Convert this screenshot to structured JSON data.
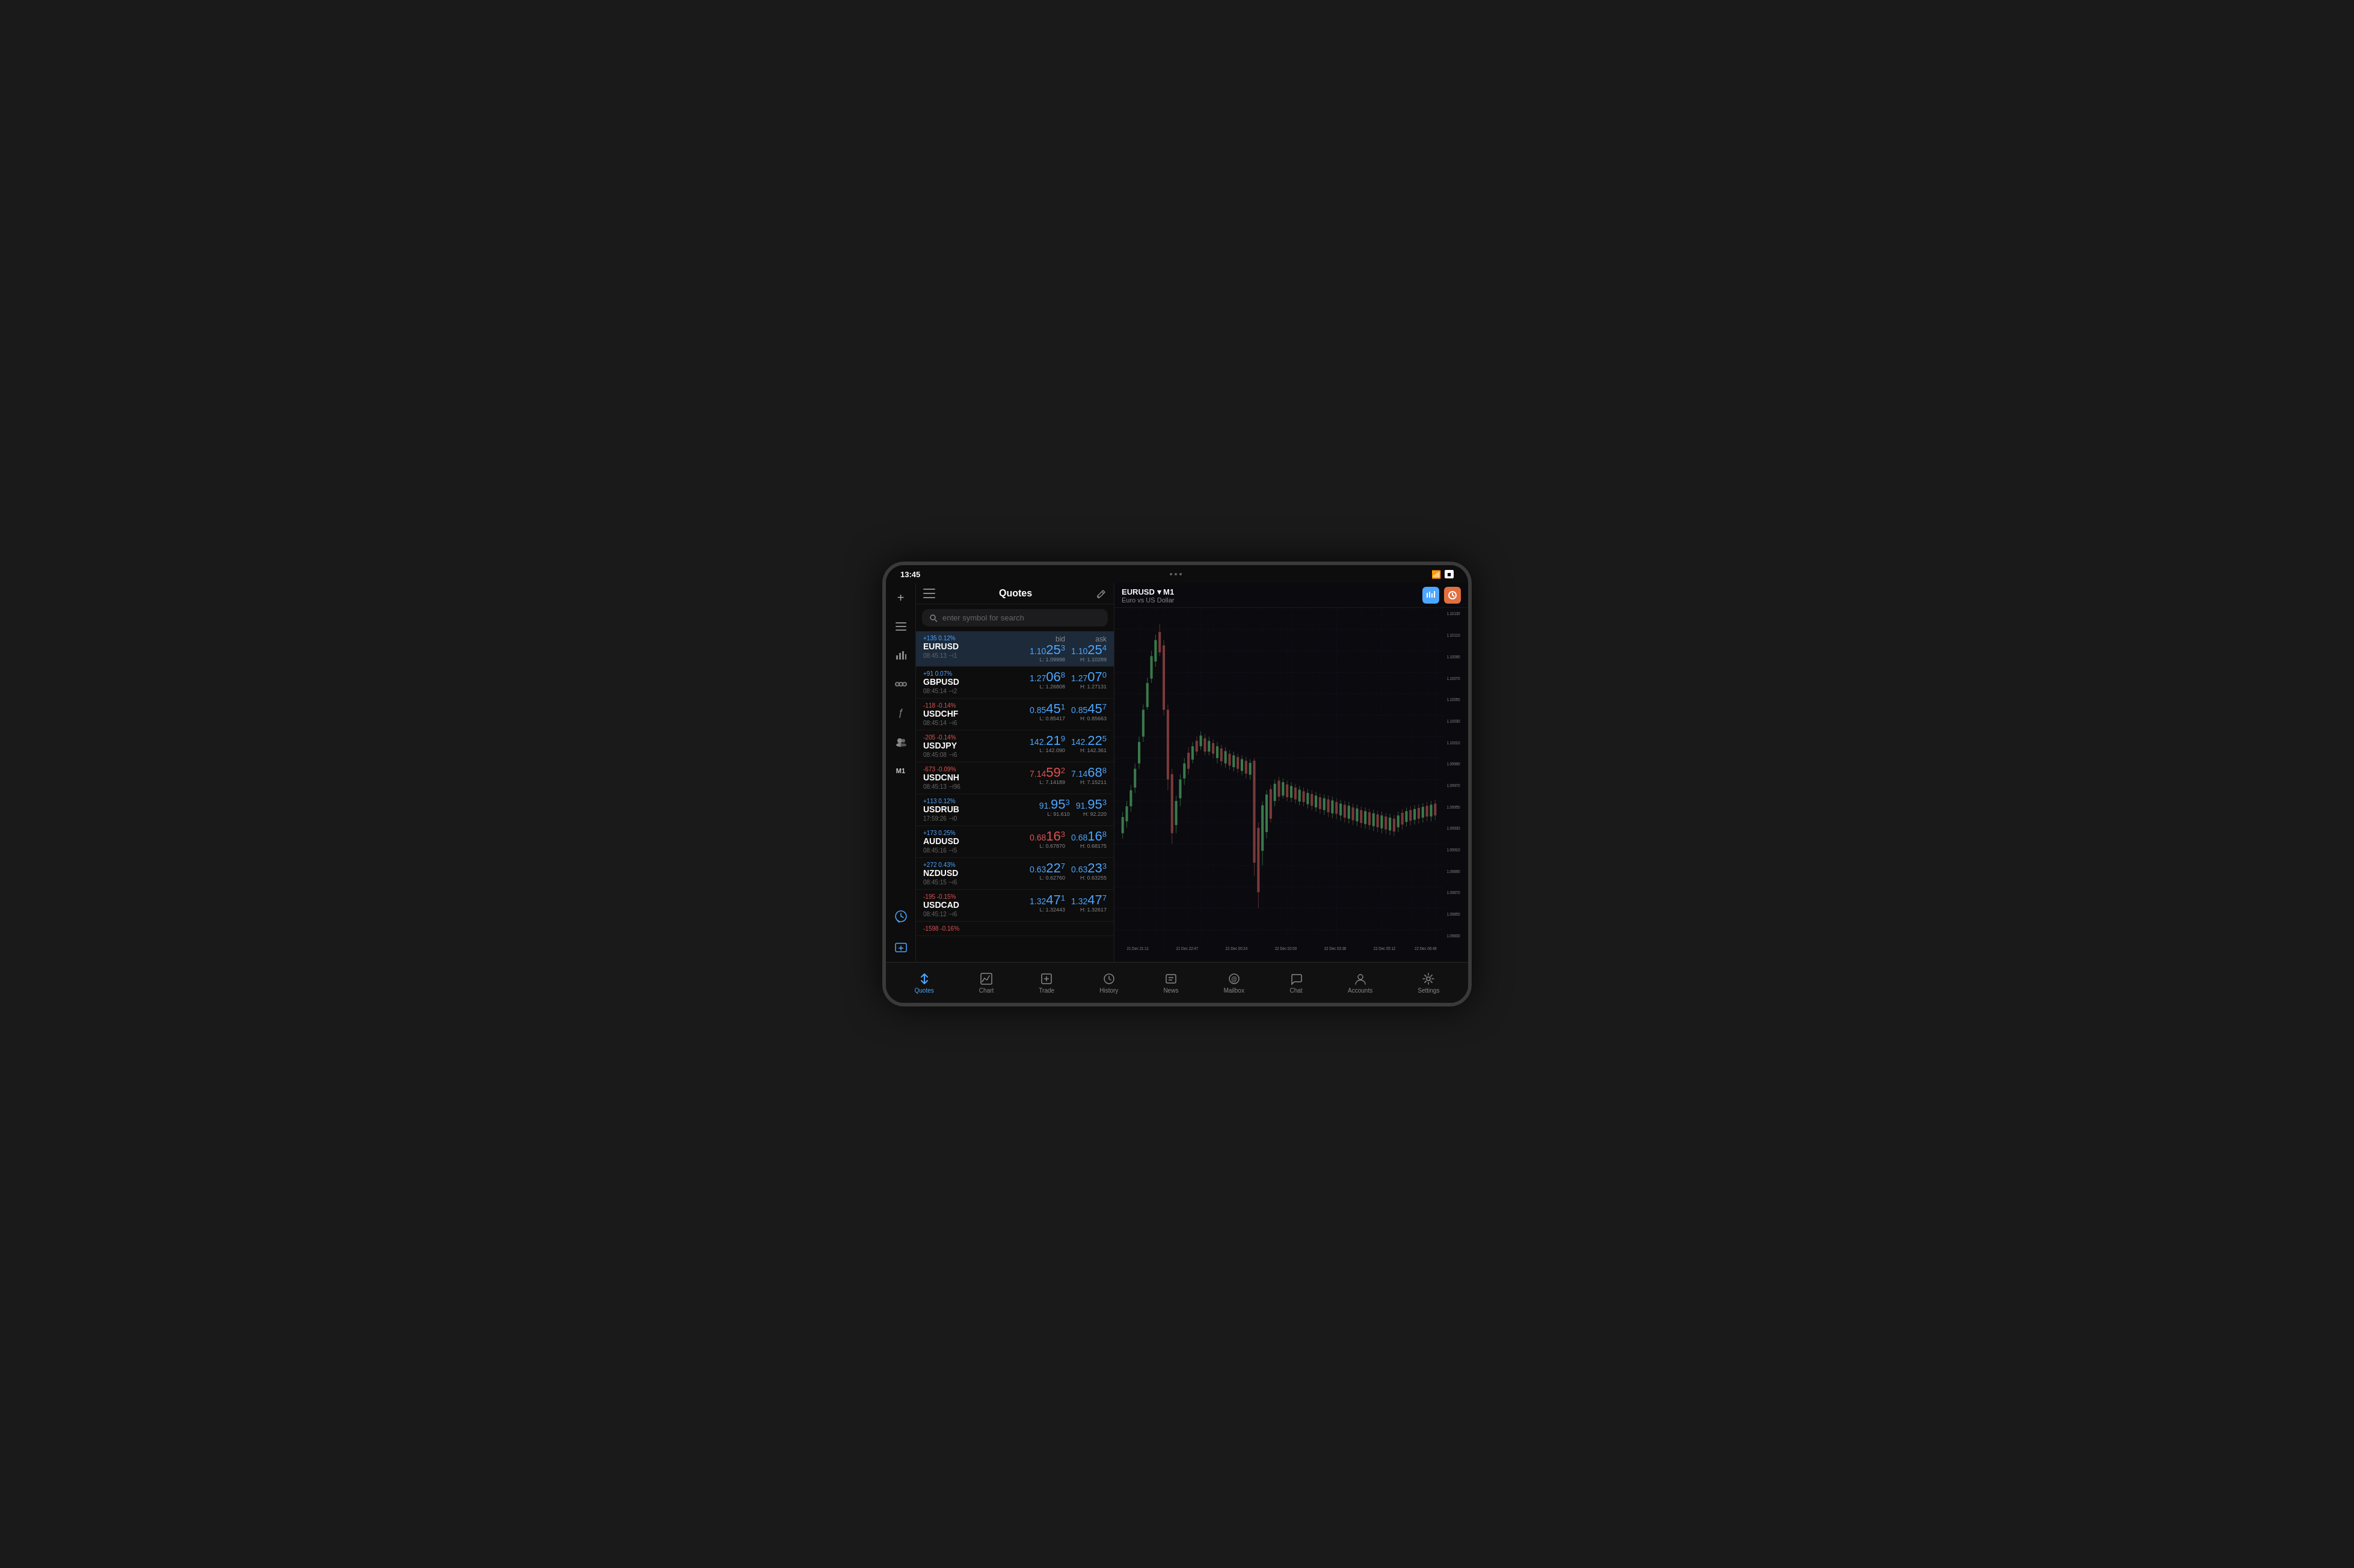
{
  "status_bar": {
    "time": "13:45",
    "wifi_icon": "wifi",
    "battery_icon": "battery"
  },
  "sidebar": {
    "icons": [
      {
        "name": "add-icon",
        "symbol": "+",
        "active": false
      },
      {
        "name": "list-icon",
        "symbol": "≡",
        "active": false
      },
      {
        "name": "chart-bar-icon",
        "symbol": "📊",
        "active": false
      },
      {
        "name": "filter-icon",
        "symbol": "⚙",
        "active": false
      },
      {
        "name": "script-icon",
        "symbol": "ƒ",
        "active": false
      },
      {
        "name": "social-icon",
        "symbol": "👥",
        "active": false
      },
      {
        "name": "m1-label",
        "symbol": "M1",
        "active": true
      }
    ],
    "bottom_icons": [
      {
        "name": "chart-bottom-icon",
        "symbol": "◎"
      },
      {
        "name": "add-bottom-icon",
        "symbol": "⊕"
      }
    ]
  },
  "quotes_panel": {
    "title": "Quotes",
    "search_placeholder": "enter symbol for search",
    "items": [
      {
        "change": "+135 0.12%",
        "change_positive": true,
        "symbol": "EURUSD",
        "time": "08:45:13",
        "spread": "1",
        "bid": "1.1025",
        "bid_sup": "3",
        "ask": "1.1025",
        "ask_sup": "4",
        "low": "L: 1.09998",
        "high": "H: 1.10289",
        "active": true
      },
      {
        "change": "+91 0.07%",
        "change_positive": true,
        "symbol": "GBPUSD",
        "time": "08:45:14",
        "spread": "2",
        "bid": "1.2706",
        "bid_sup": "8",
        "ask": "1.2707",
        "ask_sup": "0",
        "low": "L: 1.26808",
        "high": "H: 1.27131",
        "active": false
      },
      {
        "change": "-118 -0.14%",
        "change_positive": false,
        "symbol": "USDCHF",
        "time": "08:45:14",
        "spread": "6",
        "bid": "0.8545",
        "bid_sup": "1",
        "ask": "0.8545",
        "ask_sup": "7",
        "low": "L: 0.85417",
        "high": "H: 0.85663",
        "active": false
      },
      {
        "change": "-205 -0.14%",
        "change_positive": false,
        "symbol": "USDJPY",
        "time": "08:45:08",
        "spread": "6",
        "bid": "142.21",
        "bid_sup": "9",
        "ask": "142.22",
        "ask_sup": "5",
        "low": "L: 142.090",
        "high": "H: 142.361",
        "active": false
      },
      {
        "change": "-673 -0.09%",
        "change_positive": false,
        "symbol": "USDCNH",
        "time": "08:45:13",
        "spread": "96",
        "bid": "7.1459",
        "bid_sup": "2",
        "ask": "7.1468",
        "ask_sup": "8",
        "low": "L: 7.14189",
        "high": "H: 7.15211",
        "active": false
      },
      {
        "change": "+113 0.12%",
        "change_positive": true,
        "symbol": "USDRUB",
        "time": "17:59:26",
        "spread": "0",
        "bid": "91.95",
        "bid_sup": "3",
        "ask": "91.95",
        "ask_sup": "3",
        "low": "L: 91.610",
        "high": "H: 92.220",
        "active": false
      },
      {
        "change": "+173 0.25%",
        "change_positive": true,
        "symbol": "AUDUSD",
        "time": "08:45:16",
        "spread": "5",
        "bid": "0.6816",
        "bid_sup": "3",
        "ask": "0.6816",
        "ask_sup": "8",
        "low": "L: 0.67870",
        "high": "H: 0.68175",
        "active": false,
        "bid_red": true
      },
      {
        "change": "+272 0.43%",
        "change_positive": true,
        "symbol": "NZDUSD",
        "time": "08:45:15",
        "spread": "6",
        "bid": "0.6322",
        "bid_sup": "7",
        "ask": "0.6323",
        "ask_sup": "3",
        "low": "L: 0.62760",
        "high": "H: 0.63255",
        "active": false
      },
      {
        "change": "-195 -0.15%",
        "change_positive": false,
        "symbol": "USDCAD",
        "time": "08:45:12",
        "spread": "6",
        "bid": "1.3247",
        "bid_sup": "1",
        "ask": "1.3247",
        "ask_sup": "7",
        "low": "L: 1.32443",
        "high": "H: 1.32617",
        "active": false
      },
      {
        "change": "-1598 -0.16%",
        "change_positive": false,
        "symbol": "",
        "time": "",
        "spread": "",
        "bid": "",
        "bid_sup": "",
        "ask": "",
        "ask_sup": "",
        "low": "",
        "high": "",
        "active": false,
        "partial": true
      }
    ]
  },
  "chart": {
    "symbol": "EURUSD",
    "timeframe": "M1",
    "description": "Euro vs US Dollar",
    "price_levels": [
      "1.10130",
      "1.10110",
      "1.10090",
      "1.10070",
      "1.10050",
      "1.10030",
      "1.10010",
      "1.09990",
      "1.09970",
      "1.09950",
      "1.09930",
      "1.09910",
      "1.09890",
      "1.09870",
      "1.09850",
      "1.09830"
    ],
    "time_labels": [
      "21 Dec 21:11",
      "21 Dec 22:47",
      "22 Dec 00:24",
      "22 Dec 02:00",
      "22 Dec 03:36",
      "22 Dec 05:12",
      "22 Dec 06:48"
    ]
  },
  "bottom_nav": {
    "items": [
      {
        "id": "quotes",
        "icon": "↑↓",
        "label": "Quotes",
        "active": true
      },
      {
        "id": "chart",
        "icon": "📈",
        "label": "Chart",
        "active": false
      },
      {
        "id": "trade",
        "icon": "⬜",
        "label": "Trade",
        "active": false
      },
      {
        "id": "history",
        "icon": "🕐",
        "label": "History",
        "active": false
      },
      {
        "id": "news",
        "icon": "📰",
        "label": "News",
        "active": false
      },
      {
        "id": "mailbox",
        "icon": "@",
        "label": "Mailbox",
        "active": false
      },
      {
        "id": "chat",
        "icon": "💬",
        "label": "Chat",
        "active": false
      },
      {
        "id": "accounts",
        "icon": "👤",
        "label": "Accounts",
        "active": false
      },
      {
        "id": "settings",
        "icon": "⚙",
        "label": "Settings",
        "active": false
      }
    ]
  }
}
